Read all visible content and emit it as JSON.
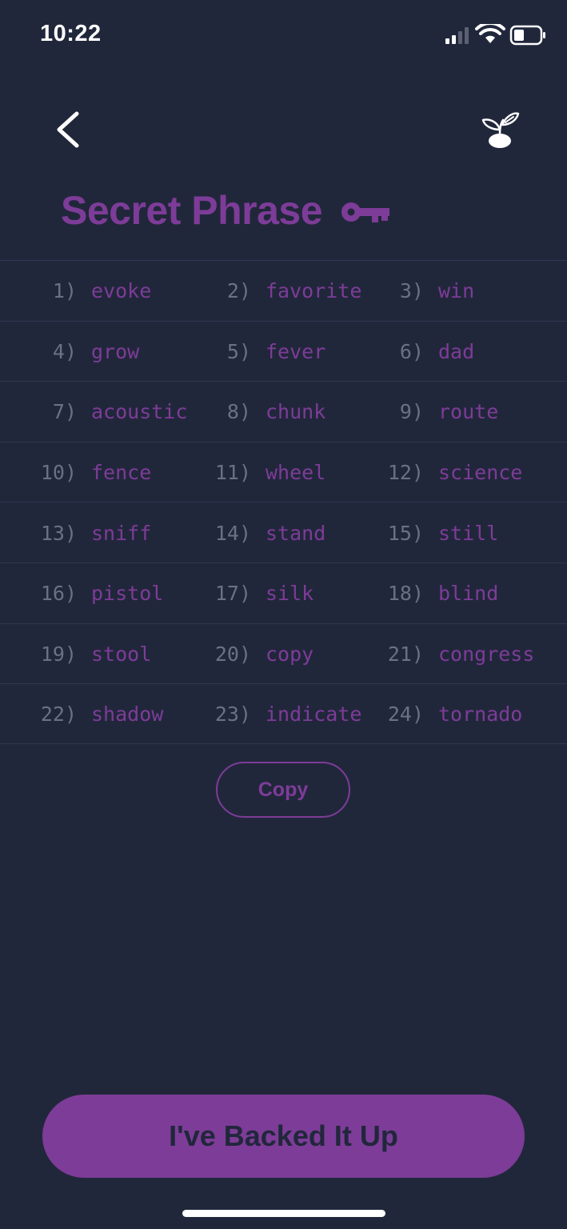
{
  "status_bar": {
    "time": "10:22",
    "icons": [
      "cellular-signal-icon",
      "wifi-icon",
      "battery-icon"
    ]
  },
  "nav": {
    "back_icon": "chevron-left-icon",
    "right_icon": "plant-sprout-icon"
  },
  "header": {
    "title": "Secret Phrase",
    "title_icon": "key-icon"
  },
  "phrase": {
    "rows": [
      [
        {
          "num": "1)",
          "word": "evoke"
        },
        {
          "num": "2)",
          "word": "favorite"
        },
        {
          "num": "3)",
          "word": "win"
        }
      ],
      [
        {
          "num": "4)",
          "word": "grow"
        },
        {
          "num": "5)",
          "word": "fever"
        },
        {
          "num": "6)",
          "word": "dad"
        }
      ],
      [
        {
          "num": "7)",
          "word": "acoustic"
        },
        {
          "num": "8)",
          "word": "chunk"
        },
        {
          "num": "9)",
          "word": "route"
        }
      ],
      [
        {
          "num": "10)",
          "word": "fence"
        },
        {
          "num": "11)",
          "word": "wheel"
        },
        {
          "num": "12)",
          "word": "science"
        }
      ],
      [
        {
          "num": "13)",
          "word": "sniff"
        },
        {
          "num": "14)",
          "word": "stand"
        },
        {
          "num": "15)",
          "word": "still"
        }
      ],
      [
        {
          "num": "16)",
          "word": "pistol"
        },
        {
          "num": "17)",
          "word": "silk"
        },
        {
          "num": "18)",
          "word": "blind"
        }
      ],
      [
        {
          "num": "19)",
          "word": "stool"
        },
        {
          "num": "20)",
          "word": "copy"
        },
        {
          "num": "21)",
          "word": "congress"
        }
      ],
      [
        {
          "num": "22)",
          "word": "shadow"
        },
        {
          "num": "23)",
          "word": "indicate"
        },
        {
          "num": "24)",
          "word": "tornado"
        }
      ]
    ]
  },
  "actions": {
    "copy_label": "Copy",
    "confirm_label": "I've Backed It Up"
  },
  "colors": {
    "background": "#21273b",
    "accent": "#7d3c98",
    "muted_number": "#6a7085",
    "divider": "#2f3650"
  }
}
